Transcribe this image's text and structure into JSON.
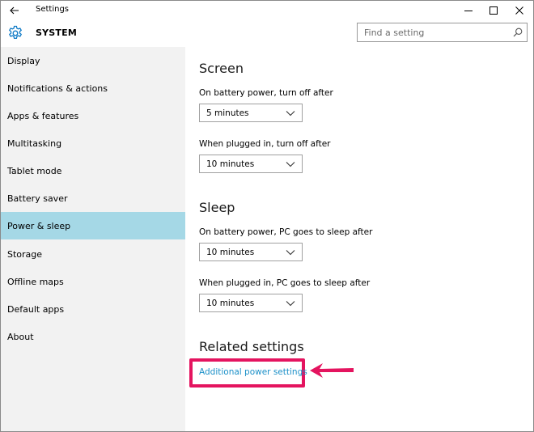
{
  "window": {
    "app_title": "Settings",
    "controls": {
      "back_icon": "back-arrow-icon",
      "minimize_icon": "minimize-icon",
      "maximize_icon": "maximize-icon",
      "close_icon": "close-icon"
    }
  },
  "header": {
    "icon": "gear-icon",
    "title": "SYSTEM",
    "search": {
      "placeholder": "Find a setting",
      "value": "",
      "icon": "search-icon"
    }
  },
  "sidebar": {
    "items": [
      {
        "label": "Display",
        "active": false
      },
      {
        "label": "Notifications & actions",
        "active": false
      },
      {
        "label": "Apps & features",
        "active": false
      },
      {
        "label": "Multitasking",
        "active": false
      },
      {
        "label": "Tablet mode",
        "active": false
      },
      {
        "label": "Battery saver",
        "active": false
      },
      {
        "label": "Power & sleep",
        "active": true
      },
      {
        "label": "Storage",
        "active": false
      },
      {
        "label": "Offline maps",
        "active": false
      },
      {
        "label": "Default apps",
        "active": false
      },
      {
        "label": "About",
        "active": false
      }
    ]
  },
  "main": {
    "screen": {
      "heading": "Screen",
      "battery_label": "On battery power, turn off after",
      "battery_value": "5 minutes",
      "plugged_label": "When plugged in, turn off after",
      "plugged_value": "10 minutes"
    },
    "sleep": {
      "heading": "Sleep",
      "battery_label": "On battery power, PC goes to sleep after",
      "battery_value": "10 minutes",
      "plugged_label": "When plugged in, PC goes to sleep after",
      "plugged_value": "10 minutes"
    },
    "related": {
      "heading": "Related settings",
      "link": "Additional power settings"
    }
  },
  "colors": {
    "sidebar_bg": "#f2f2f2",
    "active_item_bg": "#a5d8e6",
    "link": "#1a8fc8",
    "highlight": "#e4145f",
    "accent_icon": "#0f7ac6"
  }
}
